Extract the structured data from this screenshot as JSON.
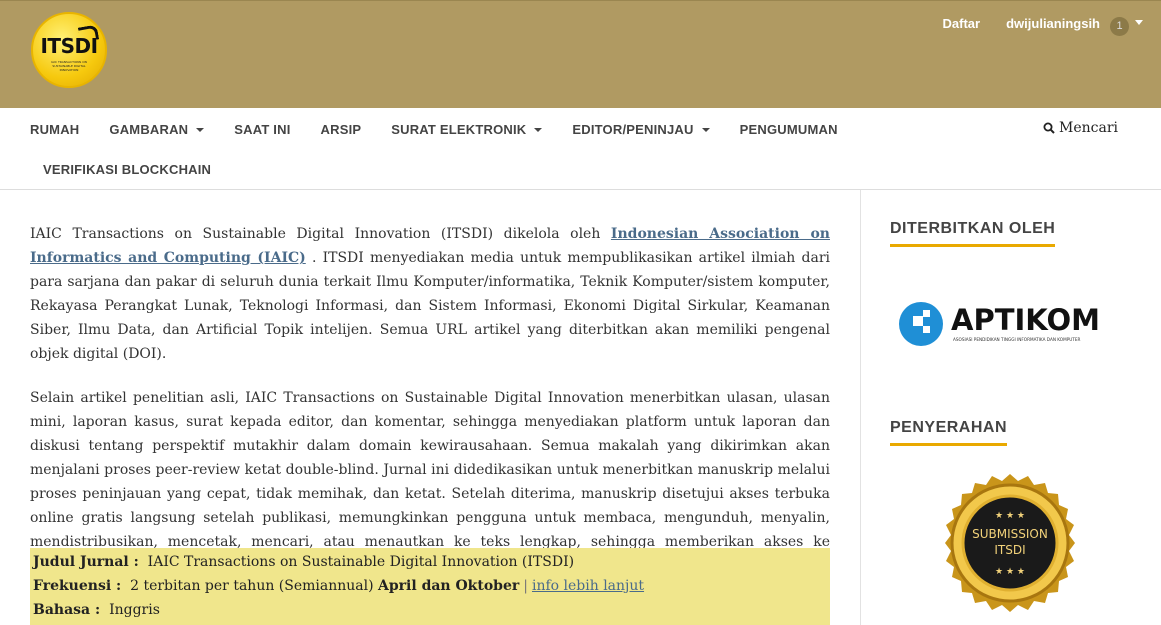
{
  "header": {
    "logo_text": "ITSDI",
    "logo_sub": "IAIC TRANSACTIONS ON SUSTAINABLE DIGITAL INNOVATION",
    "register": "Daftar",
    "username": "dwijulianingsih",
    "notif_count": "1"
  },
  "nav": {
    "items": [
      "RUMAH",
      "GAMBARAN",
      "SAAT INI",
      "ARSIP",
      "SURAT ELEKTRONIK",
      "EDITOR/PENINJAU",
      "PENGUMUMAN"
    ],
    "row2": "VERIFIKASI BLOCKCHAIN",
    "search": "Mencari"
  },
  "main": {
    "p1_before": "IAIC Transactions on Sustainable Digital Innovation (ITSDI) dikelola oleh ",
    "p1_link": "Indonesian Association on Informatics and Computing (IAIC)",
    "p1_after": " . ITSDI menyediakan media untuk mempublikasikan artikel ilmiah dari para sarjana dan pakar di seluruh dunia terkait Ilmu Komputer/informatika, Teknik Komputer/sistem komputer, Rekayasa Perangkat Lunak, Teknologi Informasi, dan Sistem Informasi, Ekonomi Digital Sirkular, Keamanan Siber, Ilmu Data, dan Artificial Topik intelijen. Semua URL artikel yang diterbitkan akan memiliki pengenal objek digital (DOI).",
    "p2": "Selain artikel penelitian asli, IAIC Transactions on Sustainable Digital Innovation menerbitkan ulasan, ulasan mini, laporan kasus, surat kepada editor, dan komentar, sehingga menyediakan platform untuk laporan dan diskusi tentang perspektif mutakhir dalam domain kewirausahaan. Semua makalah yang dikirimkan akan menjalani proses peer-review ketat double-blind. Jurnal ini didedikasikan untuk menerbitkan manuskrip melalui proses peninjauan yang cepat, tidak memihak, dan ketat. Setelah diterima, manuskrip disetujui akses terbuka online gratis langsung setelah publikasi, memungkinkan pengguna untuk membaca, mengunduh, menyalin, mendistribusikan, mencetak, mencari, atau menautkan ke teks lengkap, sehingga memberikan akses ke pembaca yang luas."
  },
  "info": {
    "title_label": "Judul Jurnal :",
    "title_value": "IAIC Transactions on Sustainable Digital Innovation (ITSDI)",
    "freq_label": "Frekuensi :",
    "freq_value": "2 terbitan per tahun (Semiannual)",
    "freq_months": "April dan Oktober",
    "freq_sep": "|",
    "more_link": "info lebih lanjut",
    "lang_label": "Bahasa :",
    "lang_value": "Inggris"
  },
  "sidebar": {
    "published_by": "DITERBITKAN OLEH",
    "aptikom_name": "APTIKOM",
    "aptikom_sub": "ASOSIASI PENDIDIKAN TINGGI INFORMATIKA DAN KOMPUTER",
    "submission": "PENYERAHAN",
    "seal_line1": "SUBMISSION",
    "seal_line2": "ITSDI"
  },
  "colors": {
    "header_bg": "#b09a62",
    "accent": "#e9a900",
    "info_bg": "#f0e68c",
    "link": "#4a6b8a"
  }
}
